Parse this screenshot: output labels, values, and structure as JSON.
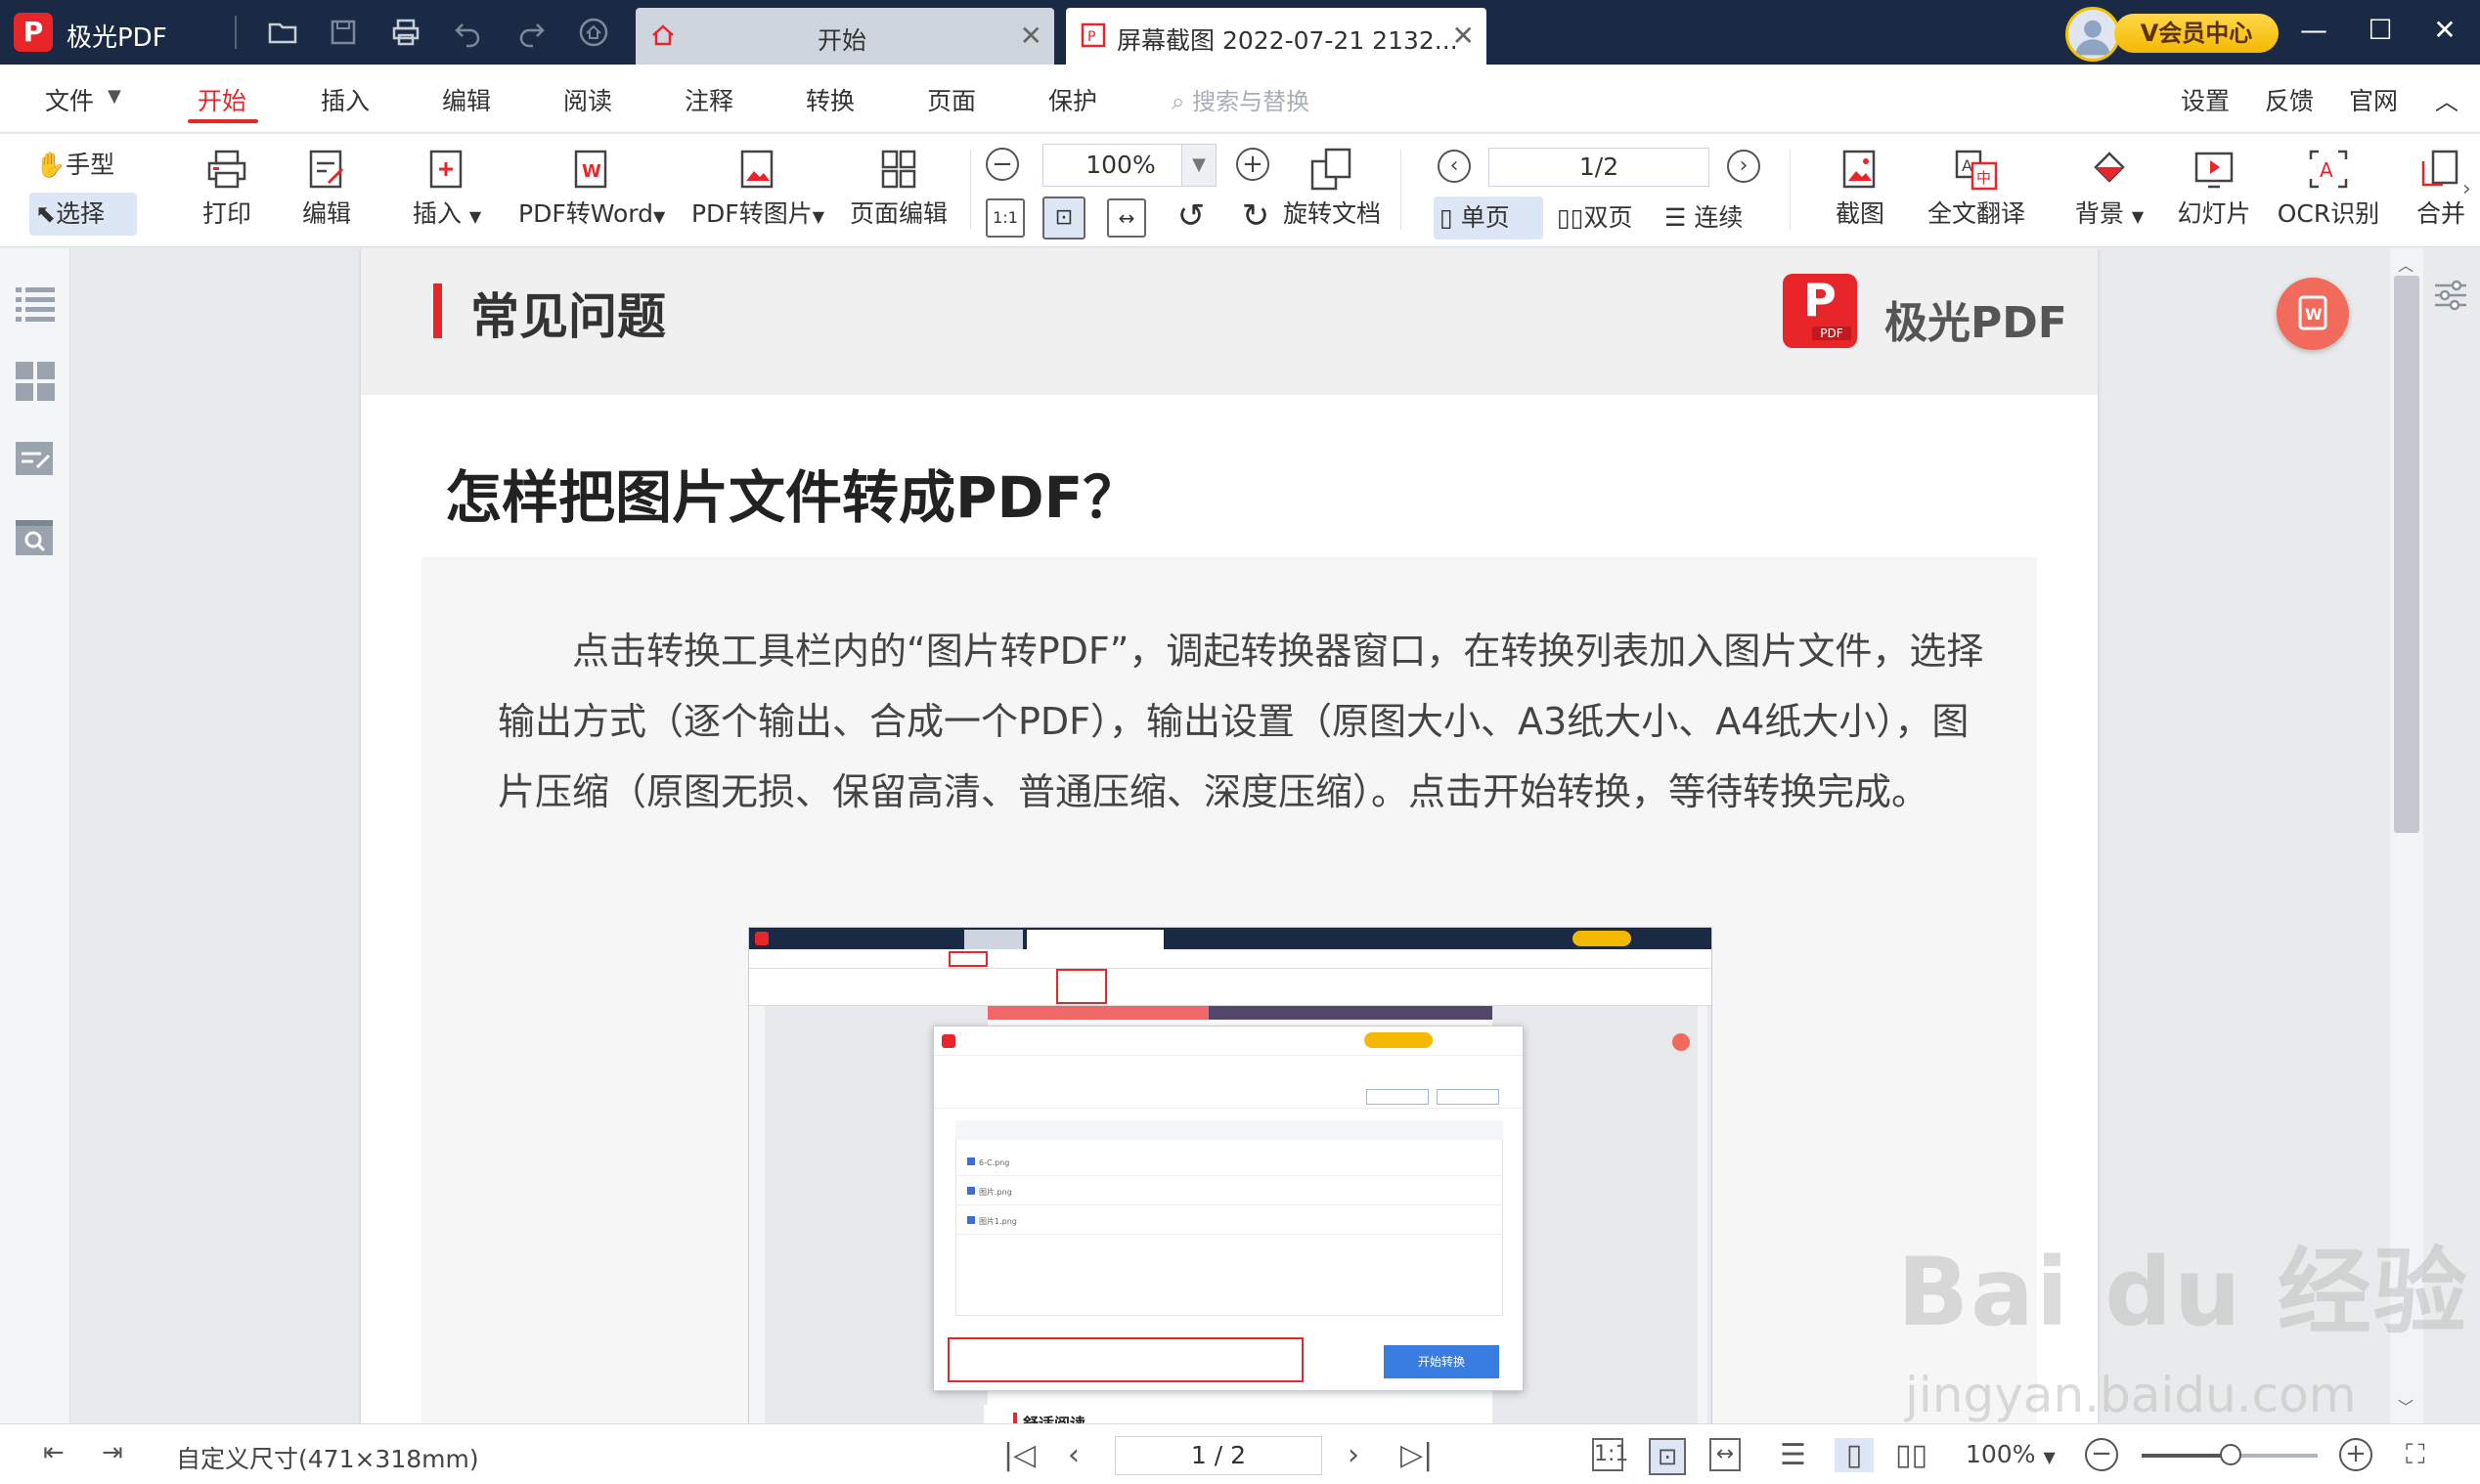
{
  "titlebar": {
    "app_name": "极光PDF",
    "logo_letter": "P",
    "tabs": [
      {
        "label": "开始"
      },
      {
        "label": "屏幕截图 2022-07-21 2132..."
      }
    ],
    "vip_label": "V会员中心",
    "win_min": "—",
    "win_max": "☐",
    "win_close": "✕"
  },
  "menubar": {
    "items": [
      "文件",
      "开始",
      "插入",
      "编辑",
      "阅读",
      "注释",
      "转换",
      "页面",
      "保护"
    ],
    "search_placeholder": "搜索与替换",
    "right_links": [
      "设置",
      "反馈",
      "官网"
    ]
  },
  "ribbon": {
    "hand_tool": "手型",
    "select_tool": "选择",
    "print": "打印",
    "edit": "编辑",
    "insert": "插入",
    "pdf_to_word": "PDF转Word",
    "pdf_to_image": "PDF转图片",
    "page_edit": "页面编辑",
    "zoom_value": "100%",
    "rotate_doc": "旋转文档",
    "page_value": "1/2",
    "single_page": "单页",
    "double_page": "双页",
    "continuous": "连续",
    "screenshot": "截图",
    "full_translate": "全文翻译",
    "background": "背景",
    "slideshow": "幻灯片",
    "ocr": "OCR识别",
    "merge": "合并"
  },
  "document": {
    "header_title": "常见问题",
    "brand_logo_letter": "P",
    "brand_logo_sub": "PDF",
    "brand_name": "极光PDF",
    "question": "怎样把图片文件转成PDF？",
    "answer": "点击转换工具栏内的“图片转PDF”，调起转换器窗口，在转换列表加入图片文件，选择输出方式（逐个输出、合成一个PDF），输出设置（原图大小、A3纸大小、A4纸大小），图片压缩（原图无损、保留高清、普通压缩、深度压缩）。点击开始转换，等待转换完成。",
    "embedded_screenshot": {
      "dialog_start_button": "开始转换",
      "file_rows": [
        "6-C.png",
        "图片.png",
        "图片1.png"
      ],
      "footer_heading": "舒适阅读"
    }
  },
  "statusbar": {
    "page_size": "自定义尺寸(471×318mm)",
    "page_value": "1 / 2",
    "zoom": "100%"
  },
  "watermark": {
    "line1": "Bai du 经验",
    "line2": "jingyan.baidu.com"
  },
  "colors": {
    "accent": "#e8262a",
    "titlebar": "#1a2a44",
    "vip": "#f5b800"
  }
}
